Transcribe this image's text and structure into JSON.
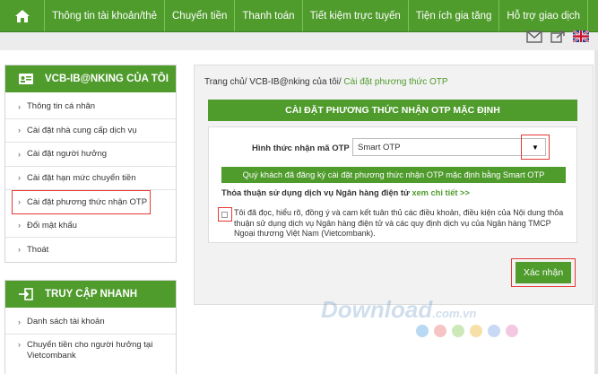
{
  "topnav": {
    "items": [
      "Thông tin tài khoản/thẻ",
      "Chuyển tiền",
      "Thanh toán",
      "Tiết kiệm trực tuyến",
      "Tiện ích gia tăng",
      "Hỗ trợ giao dịch"
    ]
  },
  "util_icons": [
    "mail-icon",
    "share-icon",
    "uk-flag-icon"
  ],
  "sidebar": {
    "my_title": "VCB-IB@NKING CỦA TÔI",
    "items": [
      "Thông tin cá nhân",
      "Cài đặt nhà cung cấp dịch vụ",
      "Cài đặt người hưởng",
      "Cài đặt hạn mức chuyển tiền",
      "Cài đặt phương thức nhận OTP",
      "Đổi mật khẩu",
      "Thoát"
    ],
    "quick_title": "TRUY CẬP NHANH",
    "quick_items": [
      "Danh sách tài khoản",
      "Chuyển tiền cho người hưởng tại Vietcombank"
    ]
  },
  "breadcrumb": {
    "home": "Trang chủ/",
    "mid": " VCB-IB@nking của tôi/",
    "current": " Cài đặt phương thức OTP"
  },
  "panel": {
    "title": "CÀI ĐẶT PHƯƠNG THỨC NHẬN OTP MẶC ĐỊNH",
    "otp_label": "Hình thức nhận mã OTP",
    "otp_value": "Smart OTP",
    "notice": "Quý khách đã đăng ký cài đặt phương thức nhận OTP mặc định bằng Smart OTP",
    "terms_label": "Thỏa thuận sử dụng dịch vụ Ngân hàng điện tử ",
    "terms_link": "xem chi tiết >>",
    "agree_text": "Tôi đã đọc, hiểu rõ, đồng ý và cam kết tuân thủ các điều khoản, điều kiện của Nội dung thỏa thuận sử dụng dịch vụ Ngân hàng điện tử và các quy định dịch vụ của Ngân hàng TMCP Ngoại thương Việt Nam (Vietcombank).",
    "confirm": "Xác nhận"
  },
  "watermark": {
    "brand": "Download",
    "suffix": ".com.vn"
  },
  "colors": {
    "brand_green": "#4f9b2c",
    "highlight_red": "#e53935"
  }
}
